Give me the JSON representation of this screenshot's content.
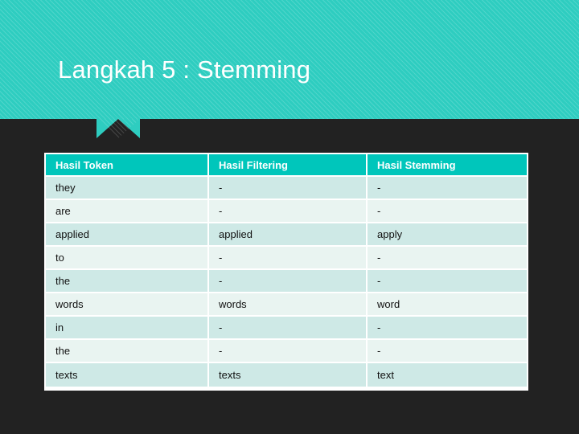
{
  "slide": {
    "background_color": "#222222",
    "title": "Langkah 5 : Stemming"
  },
  "banner": {
    "color": "#2ecdc0",
    "stripe_color": "#ffffff",
    "notch_shape": "triangle-down"
  },
  "table": {
    "header_color": "#00c6bb",
    "header_text_color": "#ffffff",
    "row_color_odd": "#cee9e6",
    "row_color_even": "#e9f4f1",
    "columns": [
      "Hasil Token",
      "Hasil Filtering",
      "Hasil Stemming"
    ],
    "rows": [
      {
        "token": "they",
        "filtering": "-",
        "stemming": "-"
      },
      {
        "token": "are",
        "filtering": "-",
        "stemming": "-"
      },
      {
        "token": "applied",
        "filtering": "applied",
        "stemming": "apply"
      },
      {
        "token": "to",
        "filtering": "-",
        "stemming": "-"
      },
      {
        "token": "the",
        "filtering": "-",
        "stemming": "-"
      },
      {
        "token": "words",
        "filtering": "words",
        "stemming": "word"
      },
      {
        "token": "in",
        "filtering": "-",
        "stemming": "-"
      },
      {
        "token": "the",
        "filtering": "-",
        "stemming": "-"
      },
      {
        "token": "texts",
        "filtering": "texts",
        "stemming": "text"
      }
    ]
  }
}
